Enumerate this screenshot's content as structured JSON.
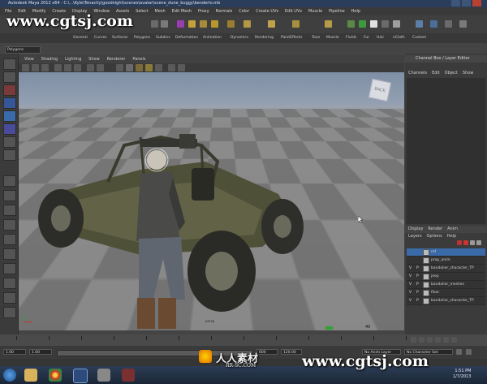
{
  "window": {
    "title": "Autodesk Maya 2012 x64 - C:\\...\\Kyle\\Tenacity\\goodnight\\scenes\\avatar\\scene_dune_buggy\\benderlo.mb"
  },
  "menubar": {
    "items": [
      "File",
      "Edit",
      "Modify",
      "Create",
      "Display",
      "Window",
      "Assets",
      "Select",
      "Mesh",
      "Edit Mesh",
      "Proxy",
      "Normals",
      "Color",
      "Create UVs",
      "Edit UVs",
      "Muscle",
      "Pipeline",
      "Help"
    ]
  },
  "shelf": {
    "tabs": [
      "General",
      "Curves",
      "Surfaces",
      "Polygons",
      "Subdivs",
      "Deformation",
      "Animation",
      "Dynamics",
      "Rendering",
      "PaintEffects",
      "Toon",
      "Muscle",
      "Fluids",
      "Fur",
      "Hair",
      "nCloth",
      "Custom"
    ]
  },
  "mode_select": {
    "value": "Polygons"
  },
  "panel": {
    "menu": [
      "View",
      "Shading",
      "Lighting",
      "Show",
      "Renderer",
      "Panels"
    ]
  },
  "viewport": {
    "label": "persp",
    "counter": "40",
    "viewcube_face": "BACK"
  },
  "right_panel": {
    "title": "Channel Box / Layer Editor",
    "channel_tabs": [
      "Channels",
      "Edit",
      "Object",
      "Show"
    ],
    "layer_tabs": [
      "Display",
      "Render",
      "Anim"
    ],
    "layer_menu": [
      "Layers",
      "Options",
      "Help"
    ],
    "layers": [
      {
        "v": "",
        "p": "",
        "name": "ref",
        "selected": true
      },
      {
        "v": "",
        "p": "",
        "name": "prop_anim",
        "selected": false
      },
      {
        "v": "V",
        "p": "P",
        "name": "bandolier_character_TP",
        "selected": false
      },
      {
        "v": "V",
        "p": "P",
        "name": "jeep",
        "selected": false
      },
      {
        "v": "V",
        "p": "P",
        "name": "bandolier_meshes",
        "selected": false
      },
      {
        "v": "V",
        "p": "P",
        "name": "floor",
        "selected": false
      },
      {
        "v": "V",
        "p": "P",
        "name": "bandolier_character_TP",
        "selected": false
      }
    ]
  },
  "timeline": {
    "start": "1.00",
    "end": "120.00",
    "range_start": "1.00",
    "range_end": "600",
    "anim_layer": "No Anim Layer",
    "char_set": "No Character Set"
  },
  "taskbar": {
    "time": "1:51 PM",
    "date": "1/7/2013"
  },
  "watermarks": {
    "top_left": "www.cgtsj.com",
    "bottom_right": "www.cgtsj.com",
    "logo_text": "人人素材",
    "logo_sub": "RR-SC.COM"
  },
  "colors": {
    "accent_layer_selected": "#3a6aa8",
    "maya_blue": "#2a3d5a"
  }
}
